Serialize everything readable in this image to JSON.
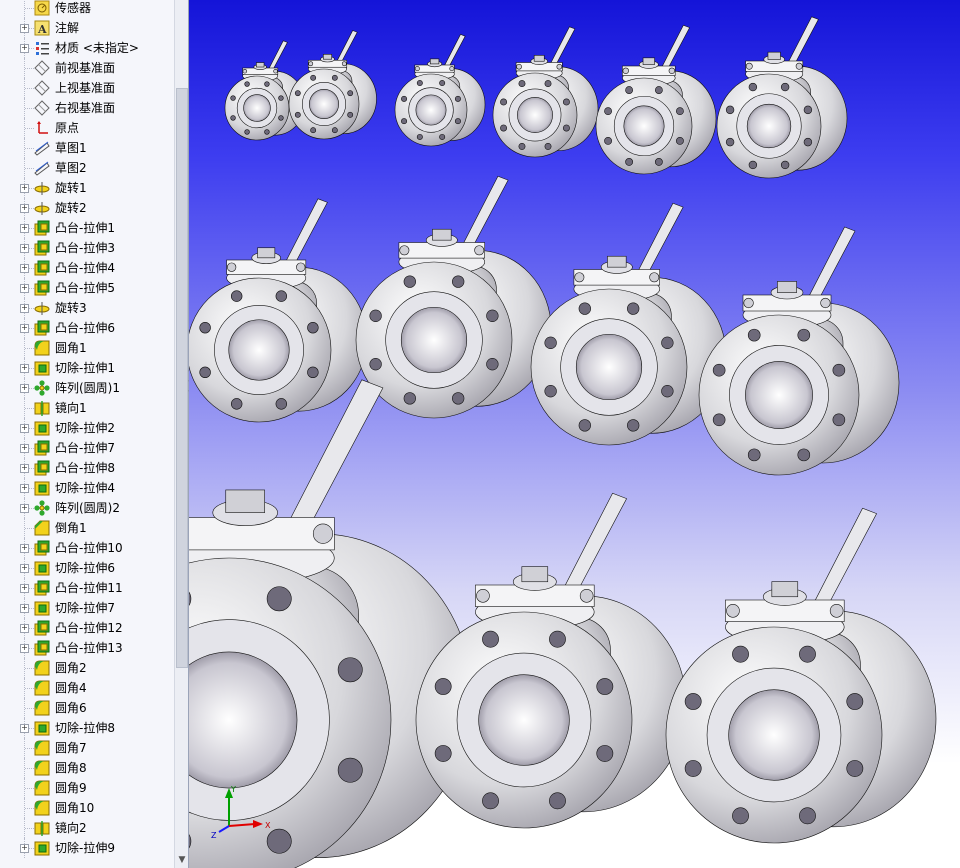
{
  "feature_tree": {
    "items": [
      {
        "label": "传感器",
        "icon": "sensor-icon",
        "expandable": false
      },
      {
        "label": "注解",
        "icon": "annotation-icon",
        "expandable": true
      },
      {
        "label": "材质 <未指定>",
        "icon": "material-icon",
        "expandable": true
      },
      {
        "label": "前视基准面",
        "icon": "plane-icon",
        "expandable": false
      },
      {
        "label": "上视基准面",
        "icon": "plane-icon",
        "expandable": false
      },
      {
        "label": "右视基准面",
        "icon": "plane-icon",
        "expandable": false
      },
      {
        "label": "原点",
        "icon": "origin-icon",
        "expandable": false
      },
      {
        "label": "草图1",
        "icon": "sketch-icon",
        "expandable": false
      },
      {
        "label": "草图2",
        "icon": "sketch-icon",
        "expandable": false
      },
      {
        "label": "旋转1",
        "icon": "revolve-icon",
        "expandable": true
      },
      {
        "label": "旋转2",
        "icon": "revolve-icon",
        "expandable": true
      },
      {
        "label": "凸台-拉伸1",
        "icon": "extrude-icon",
        "expandable": true
      },
      {
        "label": "凸台-拉伸3",
        "icon": "extrude-icon",
        "expandable": true
      },
      {
        "label": "凸台-拉伸4",
        "icon": "extrude-icon",
        "expandable": true
      },
      {
        "label": "凸台-拉伸5",
        "icon": "extrude-icon",
        "expandable": true
      },
      {
        "label": "旋转3",
        "icon": "revolve-icon",
        "expandable": true
      },
      {
        "label": "凸台-拉伸6",
        "icon": "extrude-icon",
        "expandable": true
      },
      {
        "label": "圆角1",
        "icon": "fillet-icon",
        "expandable": false
      },
      {
        "label": "切除-拉伸1",
        "icon": "cut-extrude-icon",
        "expandable": true
      },
      {
        "label": "阵列(圆周)1",
        "icon": "circular-pattern-icon",
        "expandable": true
      },
      {
        "label": "镜向1",
        "icon": "mirror-icon",
        "expandable": false
      },
      {
        "label": "切除-拉伸2",
        "icon": "cut-extrude-icon",
        "expandable": true
      },
      {
        "label": "凸台-拉伸7",
        "icon": "extrude-icon",
        "expandable": true
      },
      {
        "label": "凸台-拉伸8",
        "icon": "extrude-icon",
        "expandable": true
      },
      {
        "label": "切除-拉伸4",
        "icon": "cut-extrude-icon",
        "expandable": true
      },
      {
        "label": "阵列(圆周)2",
        "icon": "circular-pattern-icon",
        "expandable": true
      },
      {
        "label": "倒角1",
        "icon": "chamfer-icon",
        "expandable": false
      },
      {
        "label": "凸台-拉伸10",
        "icon": "extrude-icon",
        "expandable": true
      },
      {
        "label": "切除-拉伸6",
        "icon": "cut-extrude-icon",
        "expandable": true
      },
      {
        "label": "凸台-拉伸11",
        "icon": "extrude-icon",
        "expandable": true
      },
      {
        "label": "切除-拉伸7",
        "icon": "cut-extrude-icon",
        "expandable": true
      },
      {
        "label": "凸台-拉伸12",
        "icon": "extrude-icon",
        "expandable": true
      },
      {
        "label": "凸台-拉伸13",
        "icon": "extrude-icon",
        "expandable": true
      },
      {
        "label": "圆角2",
        "icon": "fillet-icon",
        "expandable": false
      },
      {
        "label": "圆角4",
        "icon": "fillet-icon",
        "expandable": false
      },
      {
        "label": "圆角6",
        "icon": "fillet-icon",
        "expandable": false
      },
      {
        "label": "切除-拉伸8",
        "icon": "cut-extrude-icon",
        "expandable": true
      },
      {
        "label": "圆角7",
        "icon": "fillet-icon",
        "expandable": false
      },
      {
        "label": "圆角8",
        "icon": "fillet-icon",
        "expandable": false
      },
      {
        "label": "圆角9",
        "icon": "fillet-icon",
        "expandable": false
      },
      {
        "label": "圆角10",
        "icon": "fillet-icon",
        "expandable": false
      },
      {
        "label": "镜向2",
        "icon": "mirror-icon",
        "expandable": false
      },
      {
        "label": "切除-拉伸9",
        "icon": "cut-extrude-icon",
        "expandable": true
      }
    ]
  },
  "viewport": {
    "background_top": "#1414d8",
    "background_bottom": "#ffffff",
    "model": "ball-valve-array",
    "triad_axes": [
      "Y",
      "X",
      "Z"
    ]
  },
  "colors": {
    "tree_bg": "#f5f6fb",
    "feature_icon_yellow": "#f2d21c",
    "feature_icon_green": "#2ea82e",
    "part_metal": "#dcdce0"
  }
}
